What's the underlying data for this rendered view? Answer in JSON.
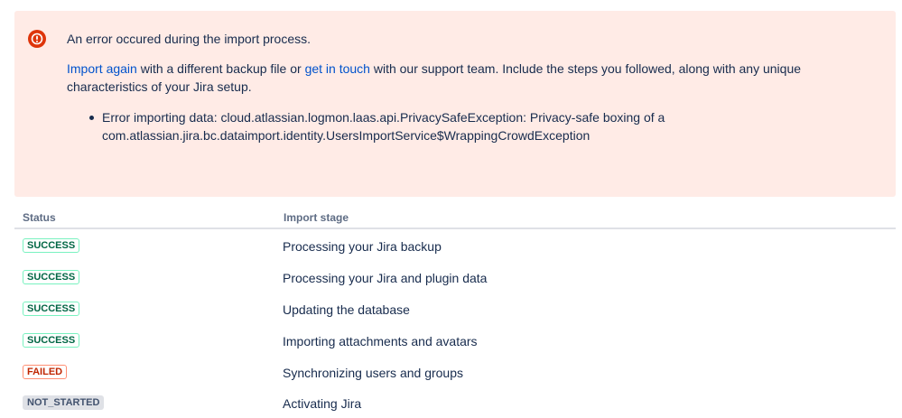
{
  "error": {
    "title": "An error occured during the import process.",
    "link_import_again": "Import again",
    "text_mid": " with a different backup file or ",
    "link_get_in_touch": "get in touch",
    "text_end": " with our support team. Include the steps you followed, along with any unique characteristics of your Jira setup.",
    "details": [
      "Error importing data: cloud.atlassian.logmon.laas.api.PrivacySafeException: Privacy-safe boxing of a com.atlassian.jira.bc.dataimport.identity.UsersImportService$WrappingCrowdException"
    ],
    "icon": "error-icon",
    "color": "#de350b"
  },
  "table": {
    "headers": {
      "status": "Status",
      "stage": "Import stage"
    },
    "rows": [
      {
        "status": "SUCCESS",
        "stage": "Processing your Jira backup"
      },
      {
        "status": "SUCCESS",
        "stage": "Processing your Jira and plugin data"
      },
      {
        "status": "SUCCESS",
        "stage": "Updating the database"
      },
      {
        "status": "SUCCESS",
        "stage": "Importing attachments and avatars"
      },
      {
        "status": "FAILED",
        "stage": "Synchronizing users and groups"
      },
      {
        "status": "NOT_STARTED",
        "stage": "Activating Jira"
      }
    ]
  }
}
